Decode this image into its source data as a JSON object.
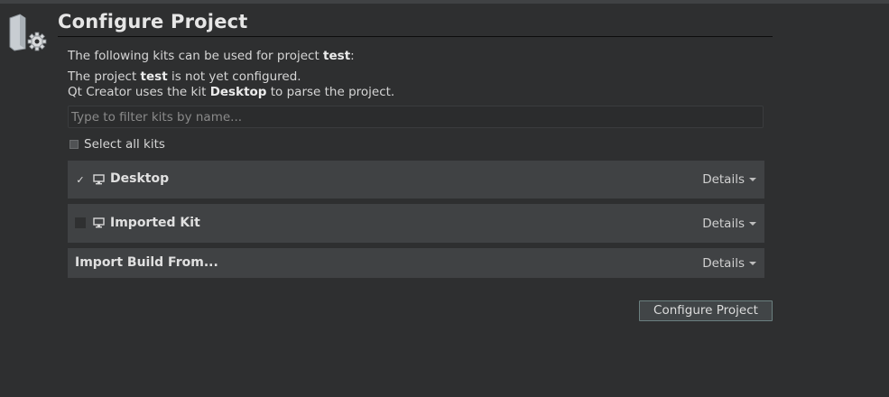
{
  "header": {
    "title": "Configure Project",
    "icon": "project-folder-gear-icon"
  },
  "messages": {
    "kits_intro_prefix": "The following kits can be used for project ",
    "kits_intro_project": "test",
    "kits_intro_suffix": ":",
    "not_configured_prefix": "The project ",
    "not_configured_project": "test",
    "not_configured_suffix": " is not yet configured.",
    "parse_prefix": "Qt Creator uses the kit ",
    "parse_kit": "Desktop",
    "parse_suffix": " to parse the project."
  },
  "filter": {
    "placeholder": "Type to filter kits by name...",
    "value": ""
  },
  "select_all": {
    "label": "Select all kits",
    "checked": false
  },
  "kits": [
    {
      "name": "Desktop",
      "checked": true,
      "icon": "monitor-icon",
      "details_label": "Details"
    },
    {
      "name": "Imported Kit",
      "checked": false,
      "icon": "monitor-icon",
      "details_label": "Details"
    }
  ],
  "import_build": {
    "label": "Import Build From...",
    "details_label": "Details"
  },
  "configure_button": {
    "label": "Configure Project"
  },
  "colors": {
    "background": "#2e2f30",
    "panel": "#404244",
    "button_border": "#6a7f7f"
  }
}
